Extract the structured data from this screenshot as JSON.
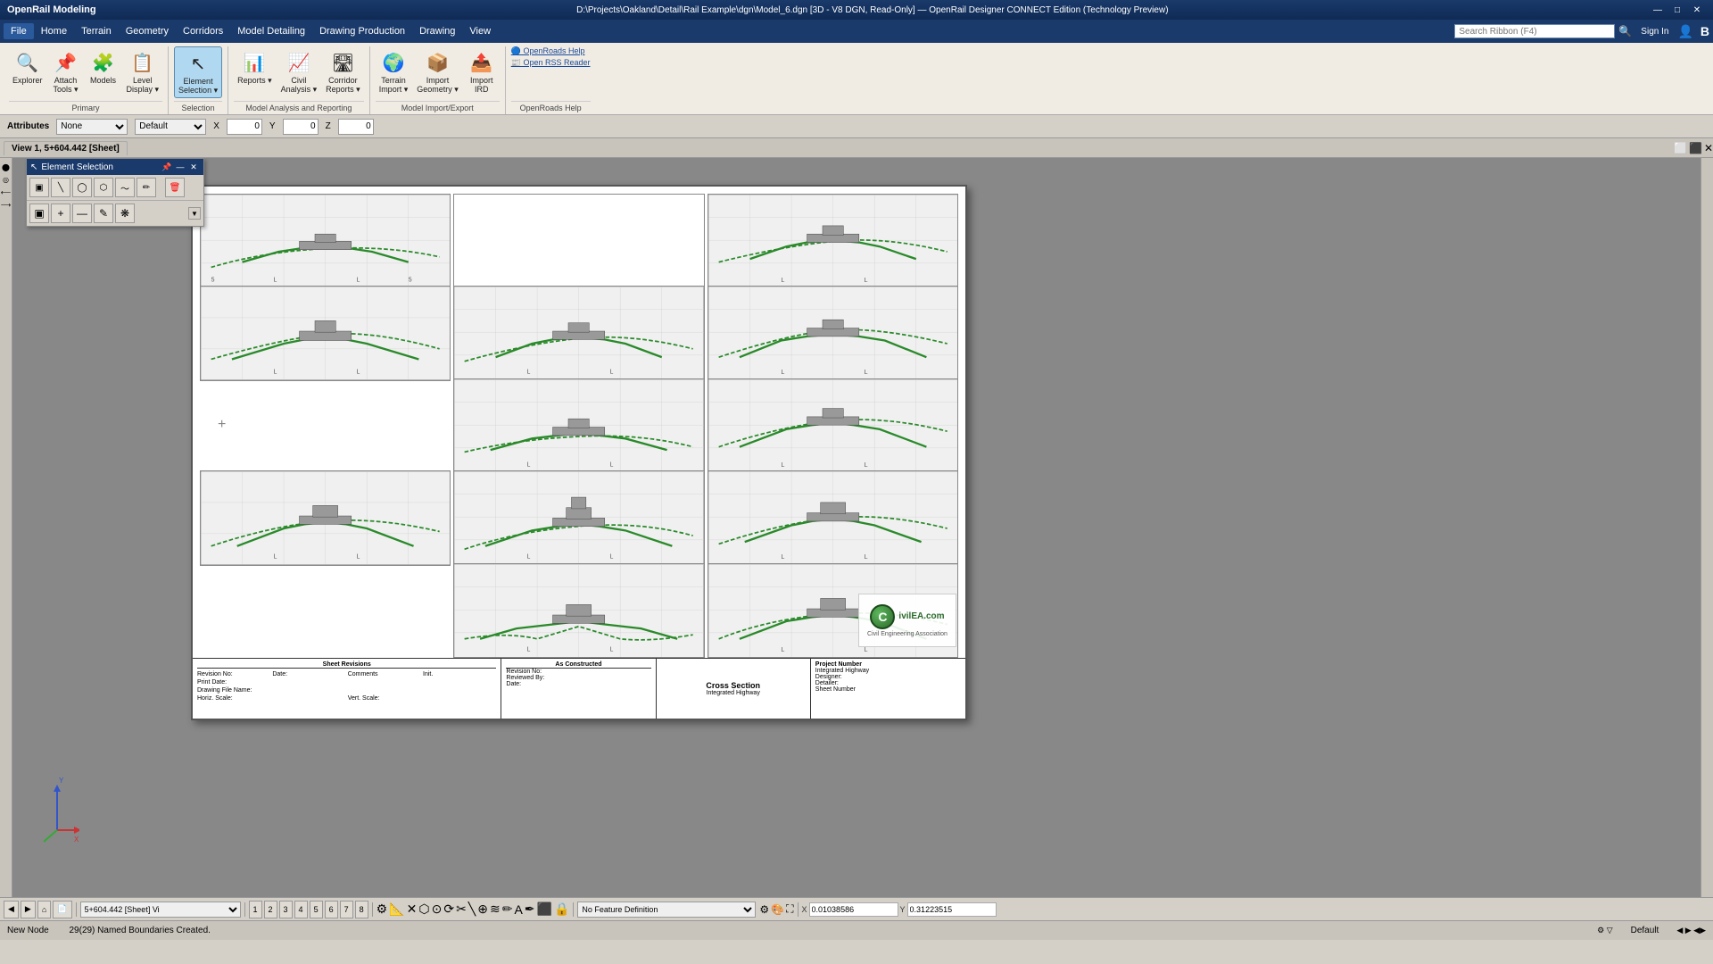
{
  "titlebar": {
    "app_name": "OpenRail Modeling",
    "document_title": "D:\\Projects\\Oakland\\Detail\\Rail Example\\dgn\\Model_6.dgn [3D - V8 DGN, Read-Only] — OpenRail Designer CONNECT Edition (Technology Preview)",
    "min_btn": "—",
    "max_btn": "□",
    "close_btn": "✕"
  },
  "menubar": {
    "items": [
      "File",
      "Home",
      "Terrain",
      "Geometry",
      "Corridors",
      "Model Detailing",
      "Drawing Production",
      "Drawing",
      "View"
    ]
  },
  "ribbon": {
    "search_placeholder": "Search Ribbon (F4)",
    "signin_label": "Sign In",
    "groups": [
      {
        "name": "Primary",
        "items": [
          {
            "icon": "🔍",
            "label": "Explorer",
            "id": "explorer"
          },
          {
            "icon": "📎",
            "label": "Attach\nTools",
            "id": "attach-tools",
            "has_dropdown": true
          },
          {
            "icon": "🧩",
            "label": "Models",
            "id": "models"
          },
          {
            "icon": "📋",
            "label": "Level\nDisplay",
            "id": "level-display",
            "has_dropdown": true
          }
        ]
      },
      {
        "name": "Selection",
        "items": [
          {
            "icon": "↖",
            "label": "Element\nSelection",
            "id": "element-selection",
            "has_dropdown": true
          }
        ]
      },
      {
        "name": "Model Analysis and Reporting",
        "items": [
          {
            "icon": "📊",
            "label": "Reports",
            "id": "reports",
            "has_dropdown": true
          },
          {
            "icon": "📈",
            "label": "Civil\nAnalysis",
            "id": "civil-analysis",
            "has_dropdown": true
          },
          {
            "icon": "📉",
            "label": "Corridor\nReports",
            "id": "corridor-reports",
            "has_dropdown": true
          }
        ]
      },
      {
        "name": "Model Import/Export",
        "items": [
          {
            "icon": "🌍",
            "label": "Terrain\nImport",
            "id": "terrain-import",
            "has_dropdown": true
          },
          {
            "icon": "📦",
            "label": "Import\nGeometry",
            "id": "import-geometry",
            "has_dropdown": true
          },
          {
            "icon": "📤",
            "label": "Import\nIRD",
            "id": "import-ird"
          }
        ]
      },
      {
        "name": "OpenRoads Help",
        "items": [
          {
            "icon": "❓",
            "label": "OpenRoads Help",
            "id": "openroads-help"
          },
          {
            "icon": "📰",
            "label": "Open RSS Reader",
            "id": "open-rss"
          }
        ]
      }
    ]
  },
  "attrbar": {
    "active_level": "None",
    "color": "Default",
    "coord_x": "0",
    "coord_y": "0",
    "coord_z": "0",
    "attributes_label": "Attributes"
  },
  "viewtab": {
    "label": "View 1, 5+604.442 [Sheet]"
  },
  "element_selection_panel": {
    "title": "Element Selection",
    "tools": [
      "▣",
      "◎",
      "⬡",
      "◻",
      "◹",
      "🖊"
    ],
    "tools2": [
      "✚",
      "—",
      "✎",
      "❋"
    ],
    "delete_btn": "🗑",
    "expand_btn": "▼"
  },
  "sheet": {
    "title": "Cross Section",
    "subtitle_left": "Print Date:\nDrawing File Name:\nHoriz. Scale:",
    "subtitle_mid": "Sheet Revisions\nDate:\nComments\nInit.",
    "subtitle_right_constructed": "As Constructed",
    "subtitle_revision": "Revision No:",
    "subtitle_reviewed": "Reviewed By:",
    "subtitle_date": "Date:",
    "project_label": "Project Number",
    "project_value": "Integrated Highway",
    "designer": "Designer:",
    "detailer": "Detailer:",
    "sheet_number_label": "Sheet Number"
  },
  "logo": {
    "site": "CivilEA.com",
    "org": "Civil Engineering Association",
    "icon_letter": "C"
  },
  "bottom_toolbar": {
    "nav_items": [
      "◀",
      "▶",
      "⌂",
      "📄"
    ],
    "view_items": [
      "1",
      "2",
      "3",
      "4",
      "5",
      "6",
      "7",
      "8"
    ],
    "current_view": "5+604.442 [Sheet] Vi",
    "status_msg": "29(29) Named Boundaries Created.",
    "feature_def": "No Feature Definition",
    "x_label": "X",
    "x_value": "0.01038586",
    "y_label": "Y",
    "y_value": "0.31223515"
  },
  "final_status": {
    "status": "New Node",
    "default_label": "Default"
  }
}
